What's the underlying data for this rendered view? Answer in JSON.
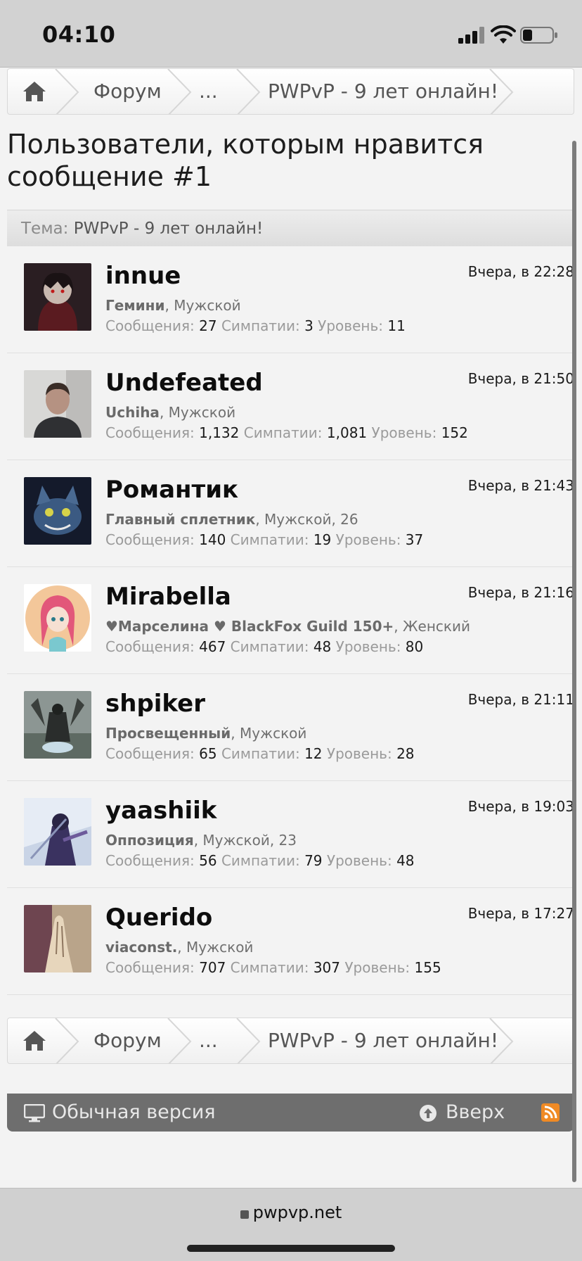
{
  "status_bar": {
    "time": "04:10"
  },
  "breadcrumb": {
    "items": [
      "Форум",
      "...",
      "PWPvP - 9 лет онлайн!"
    ]
  },
  "page": {
    "title": "Пользователи, которым нравится сообщение #1",
    "topic_label": "Тема:",
    "topic_value": "PWPvP - 9 лет онлайн!"
  },
  "stats_labels": {
    "messages": "Сообщения:",
    "likes": "Симпатии:",
    "level": "Уровень:"
  },
  "members": [
    {
      "name": "innue",
      "date": "Вчера, в 22:28",
      "title": "Гемини",
      "info": ", Мужской",
      "messages": "27",
      "likes": "3",
      "level": "11"
    },
    {
      "name": "Undefeated",
      "date": "Вчера, в 21:50",
      "title": "Uchiha",
      "info": ", Мужской",
      "messages": "1,132",
      "likes": "1,081",
      "level": "152"
    },
    {
      "name": "Романтик",
      "date": "Вчера, в 21:43",
      "title": "Главный сплетник",
      "info": ", Мужской, 26",
      "messages": "140",
      "likes": "19",
      "level": "37"
    },
    {
      "name": "Mirabella",
      "date": "Вчера, в 21:16",
      "title": "♥Марселина ♥  BlackFox Guild 150+",
      "info": ", Женский",
      "messages": "467",
      "likes": "48",
      "level": "80"
    },
    {
      "name": "shpiker",
      "date": "Вчера, в 21:11",
      "title": "Просвещенный",
      "info": ", Мужской",
      "messages": "65",
      "likes": "12",
      "level": "28"
    },
    {
      "name": "yaashiik",
      "date": "Вчера, в 19:03",
      "title": "Оппозиция",
      "info": ", Мужской, 23",
      "messages": "56",
      "likes": "79",
      "level": "48"
    },
    {
      "name": "Querido",
      "date": "Вчера, в 17:27",
      "title": "viaconst.",
      "info": ", Мужской",
      "messages": "707",
      "likes": "307",
      "level": "155"
    }
  ],
  "footer": {
    "classic_label": "Обычная версия",
    "up_label": "Вверх"
  },
  "browser": {
    "url": "pwpvp.net"
  }
}
